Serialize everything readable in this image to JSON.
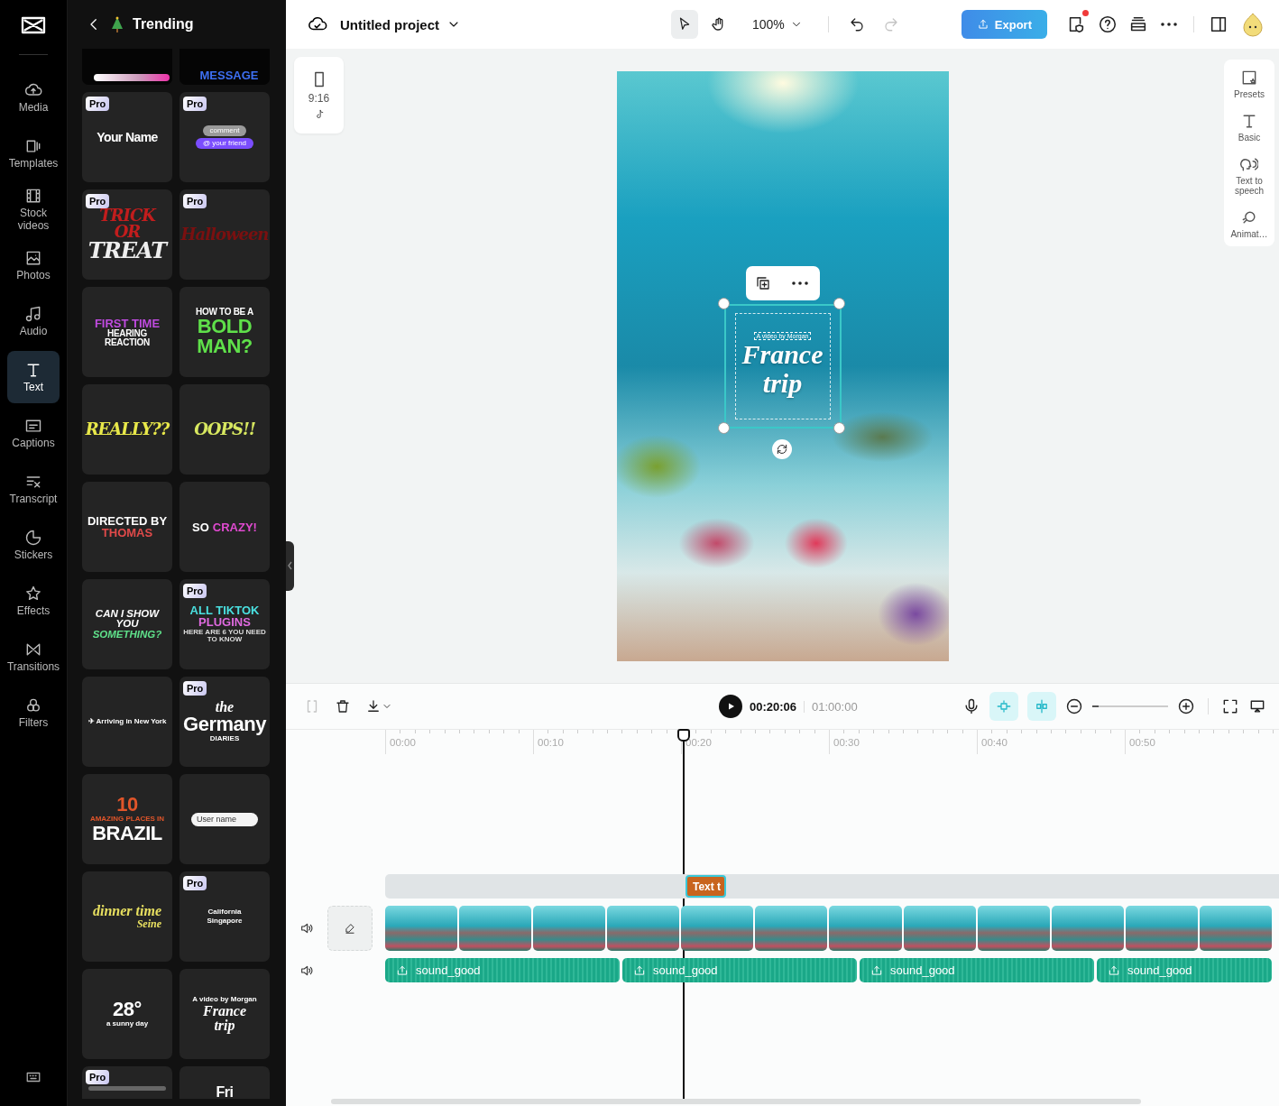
{
  "rail": {
    "items": [
      {
        "label": "Media",
        "selected": false
      },
      {
        "label": "Templates",
        "selected": false
      },
      {
        "label": "Stock videos",
        "selected": false
      },
      {
        "label": "Photos",
        "selected": false
      },
      {
        "label": "Audio",
        "selected": false
      },
      {
        "label": "Text",
        "selected": true
      },
      {
        "label": "Captions",
        "selected": false
      },
      {
        "label": "Transcript",
        "selected": false
      },
      {
        "label": "Stickers",
        "selected": false
      },
      {
        "label": "Effects",
        "selected": false
      },
      {
        "label": "Transitions",
        "selected": false
      },
      {
        "label": "Filters",
        "selected": false
      }
    ]
  },
  "panel": {
    "title": "Trending",
    "cards": [
      {
        "kind": "gradient-bar"
      },
      {
        "lines": [
          {
            "text": "MESSAGE",
            "kind": "heavy",
            "color": "#3d6ff2"
          }
        ]
      },
      {
        "badge": "Pro",
        "lines": [
          {
            "text": "Your Name",
            "kind": "condensed",
            "color": "#ffffff"
          }
        ]
      },
      {
        "badge": "Pro",
        "lines": [
          {
            "text": "comment",
            "kind": "pill",
            "color": "#9a9a9a"
          },
          {
            "text": "@ your friend",
            "kind": "pill",
            "color": "#7b4dff"
          }
        ]
      },
      {
        "badge": "Pro",
        "lines": [
          {
            "text": "TRICK OR",
            "kind": "brush",
            "color": "#c21d1d"
          },
          {
            "text": "TREAT",
            "kind": "brush-big",
            "color": "#eeeeee"
          }
        ]
      },
      {
        "badge": "Pro",
        "lines": [
          {
            "text": "Halloween",
            "kind": "brush",
            "color": "#7a1010"
          }
        ]
      },
      {
        "lines": [
          {
            "text": "FIRST TIME",
            "kind": "heavy",
            "color": "#c04be0"
          },
          {
            "text": "HEARING REACTION",
            "kind": "condensed-small",
            "color": "#ffffff"
          }
        ]
      },
      {
        "lines": [
          {
            "text": "HOW TO BE A",
            "kind": "condensed-small",
            "color": "#ffffff"
          },
          {
            "text": "BOLD",
            "kind": "heavy-big",
            "color": "#5fe04a"
          },
          {
            "text": "MAN?",
            "kind": "heavy-big",
            "color": "#5fe04a"
          }
        ]
      },
      {
        "lines": [
          {
            "text": "REALLY??",
            "kind": "brush",
            "color": "#e8e84a"
          }
        ]
      },
      {
        "lines": [
          {
            "text": "OOPS!!",
            "kind": "brush",
            "color": "#d8e860"
          }
        ]
      },
      {
        "lines": [
          {
            "text": "DIRECTED BY",
            "kind": "heavy",
            "color": "#ffffff"
          },
          {
            "text": "THOMAS",
            "kind": "heavy",
            "color": "#e04a4a"
          }
        ]
      },
      {
        "lines": [
          {
            "text": "SO",
            "kind": "heavy",
            "color": "#ffffff"
          },
          {
            "text": "CRAZY!",
            "kind": "heavy",
            "color": "#e04ad0"
          }
        ]
      },
      {
        "lines": [
          {
            "text": "CAN I SHOW YOU",
            "kind": "italic",
            "color": "#ffffff"
          },
          {
            "text": "SOMETHING?",
            "kind": "italic",
            "color": "#5fe08a"
          }
        ]
      },
      {
        "badge": "Pro",
        "lines": [
          {
            "text": "ALL TIKTOK",
            "kind": "heavy",
            "color": "#4ae0e0"
          },
          {
            "text": "PLUGINS",
            "kind": "heavy",
            "color": "#e06ae0"
          },
          {
            "text": "HERE ARE 6 YOU NEED TO KNOW",
            "kind": "tiny",
            "color": "#dddddd"
          }
        ]
      },
      {
        "lines": [
          {
            "text": "✈ Arriving in New York",
            "kind": "tiny",
            "color": "#ffffff"
          }
        ]
      },
      {
        "badge": "Pro",
        "lines": [
          {
            "text": "the",
            "kind": "script",
            "color": "#ffffff"
          },
          {
            "text": "Germany",
            "kind": "heavy-big",
            "color": "#ffffff"
          },
          {
            "text": "DIARIES",
            "kind": "tiny",
            "color": "#ffffff"
          }
        ]
      },
      {
        "lines": [
          {
            "text": "10",
            "kind": "heavy-big",
            "color": "#e0552a"
          },
          {
            "text": "AMAZING PLACES IN",
            "kind": "tiny",
            "color": "#e0552a"
          },
          {
            "text": "BRAZIL",
            "kind": "heavy-big",
            "color": "#ffffff"
          }
        ]
      },
      {
        "lines": [
          {
            "text": "User name",
            "kind": "field"
          }
        ]
      },
      {
        "lines": [
          {
            "text": "dinner time",
            "kind": "script",
            "color": "#e8e060"
          },
          {
            "text": "Seine",
            "kind": "script-small",
            "color": "#e8e060"
          }
        ]
      },
      {
        "badge": "Pro",
        "lines": [
          {
            "text": "California",
            "kind": "tiny",
            "color": "#ffffff"
          },
          {
            "text": "Singapore",
            "kind": "tiny",
            "color": "#ffffff"
          }
        ]
      },
      {
        "lines": [
          {
            "text": "28°",
            "kind": "heavy-big",
            "color": "#ffffff"
          },
          {
            "text": "a sunny day",
            "kind": "tiny",
            "color": "#ffffff"
          }
        ]
      },
      {
        "lines": [
          {
            "text": "A video by Morgan",
            "kind": "tiny",
            "color": "#ffffff"
          },
          {
            "text": "France",
            "kind": "script",
            "color": "#ffffff"
          },
          {
            "text": "trip",
            "kind": "script",
            "color": "#ffffff"
          }
        ]
      },
      {
        "badge": "Pro",
        "kind": "grey-bar"
      },
      {
        "lines": [
          {
            "text": "Fri",
            "kind": "heavy-big",
            "color": "#ffffff"
          }
        ]
      }
    ]
  },
  "topbar": {
    "project_title": "Untitled project",
    "zoom": "100%",
    "redo": {
      "disabled": true
    },
    "export": "Export",
    "notification": true
  },
  "canvas": {
    "aspect_ratio": "9:16",
    "text_overlay": {
      "selected": true,
      "lines": [
        "A video by Morgan",
        "France",
        "trip"
      ]
    }
  },
  "tools": [
    "Presets",
    "Basic",
    "Text to speech",
    "Animat…"
  ],
  "timeline": {
    "split": {
      "disabled": true
    },
    "current_time": "00:20:06",
    "duration": "01:00:00",
    "magnet": {
      "on": true
    },
    "linkage": {
      "on": true
    },
    "zoom": {
      "level": 0.08
    },
    "ruler": [
      "00:00",
      "00:10",
      "00:20",
      "00:30",
      "00:40",
      "00:50"
    ],
    "text_clip": {
      "label": "Text t",
      "selected": true
    },
    "audio_clips": [
      {
        "label": "sound_good"
      },
      {
        "label": "sound_good"
      },
      {
        "label": "sound_good"
      },
      {
        "label": "sound_good"
      }
    ]
  }
}
